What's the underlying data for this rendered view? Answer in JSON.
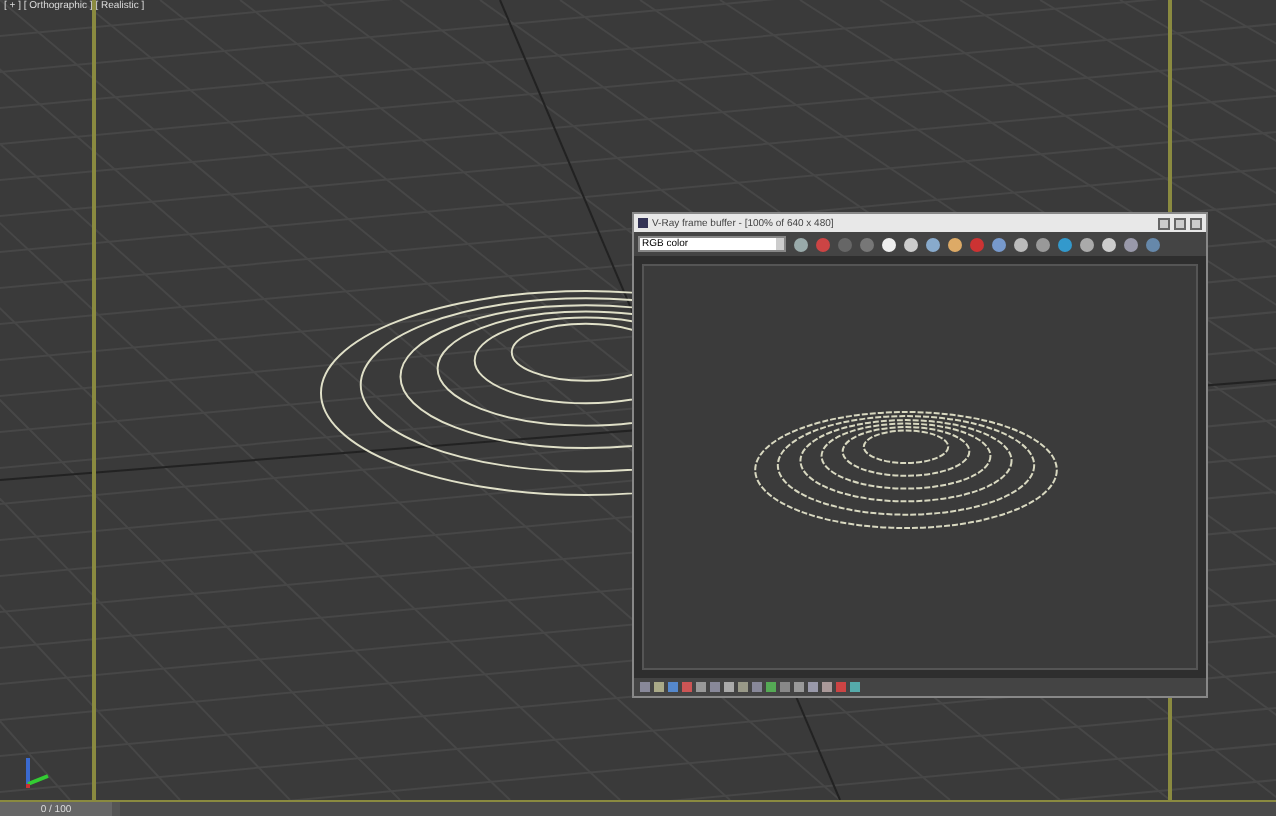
{
  "viewport": {
    "label": "[ + ] [ Orthographic ] [ Realistic ]"
  },
  "frame_buffer": {
    "title": "V-Ray frame buffer - [100% of 640 x 480]",
    "channel": "RGB color"
  },
  "timeline": {
    "reading": "0 / 100",
    "level": 0
  }
}
